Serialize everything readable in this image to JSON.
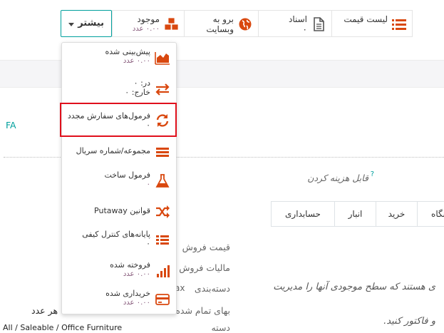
{
  "buttons": {
    "price_list": "لیست قیمت",
    "document_label": "اسناد",
    "document_count": "۰",
    "website_line1": "برو به",
    "website_line2": "وبسایت",
    "stock_label": "موجود",
    "stock_value": "۰.۰۰ عدد",
    "more": "بیشتر"
  },
  "menu": [
    {
      "label": "پیش‌بینی شده",
      "sub": "۰.۰۰ عدد",
      "icon": "area-chart-icon"
    },
    {
      "label": "در: ۰",
      "sub": "خارج: ۰",
      "icon": "exchange-icon"
    },
    {
      "label": "فرمول‌های سفارش مجدد",
      "sub": "۰",
      "icon": "refresh-icon"
    },
    {
      "label": "مجموعه/شماره سریال",
      "sub": "",
      "icon": "bars-icon"
    },
    {
      "label": "فرمول ساخت",
      "sub": "۰",
      "icon": "flask-icon"
    },
    {
      "label": "قوانین Putaway",
      "sub": "",
      "icon": "random-icon"
    },
    {
      "label": "پایانه‌های کنترل کیفی",
      "sub": "۰",
      "icon": "tasks-list-icon"
    },
    {
      "label": "فروخته شده",
      "sub": "۰.۰۰ عدد",
      "icon": "signal-icon"
    },
    {
      "label": "خریداری شده",
      "sub": "۰.۰۰ عدد",
      "icon": "credit-card-icon"
    }
  ],
  "page": {
    "fa_text": "FA",
    "expense_label": "قابل هزینه کردن",
    "tabs": [
      "حسابداری",
      "انبار",
      "خرید",
      "نگاه"
    ],
    "fields": [
      "قیمت فروش",
      "مالیات فروش",
      "دسته‌بندی",
      "بهای تمام شده",
      "دسته"
    ],
    "help1": "ی هستند که سطح موجودی آنها را مدیریت",
    "help2": "و فاکتور کنید.",
    "per_unit": "هر عدد",
    "bottom_text": "All / Saleable / Office Furniture",
    "tax_snip": "ax"
  }
}
